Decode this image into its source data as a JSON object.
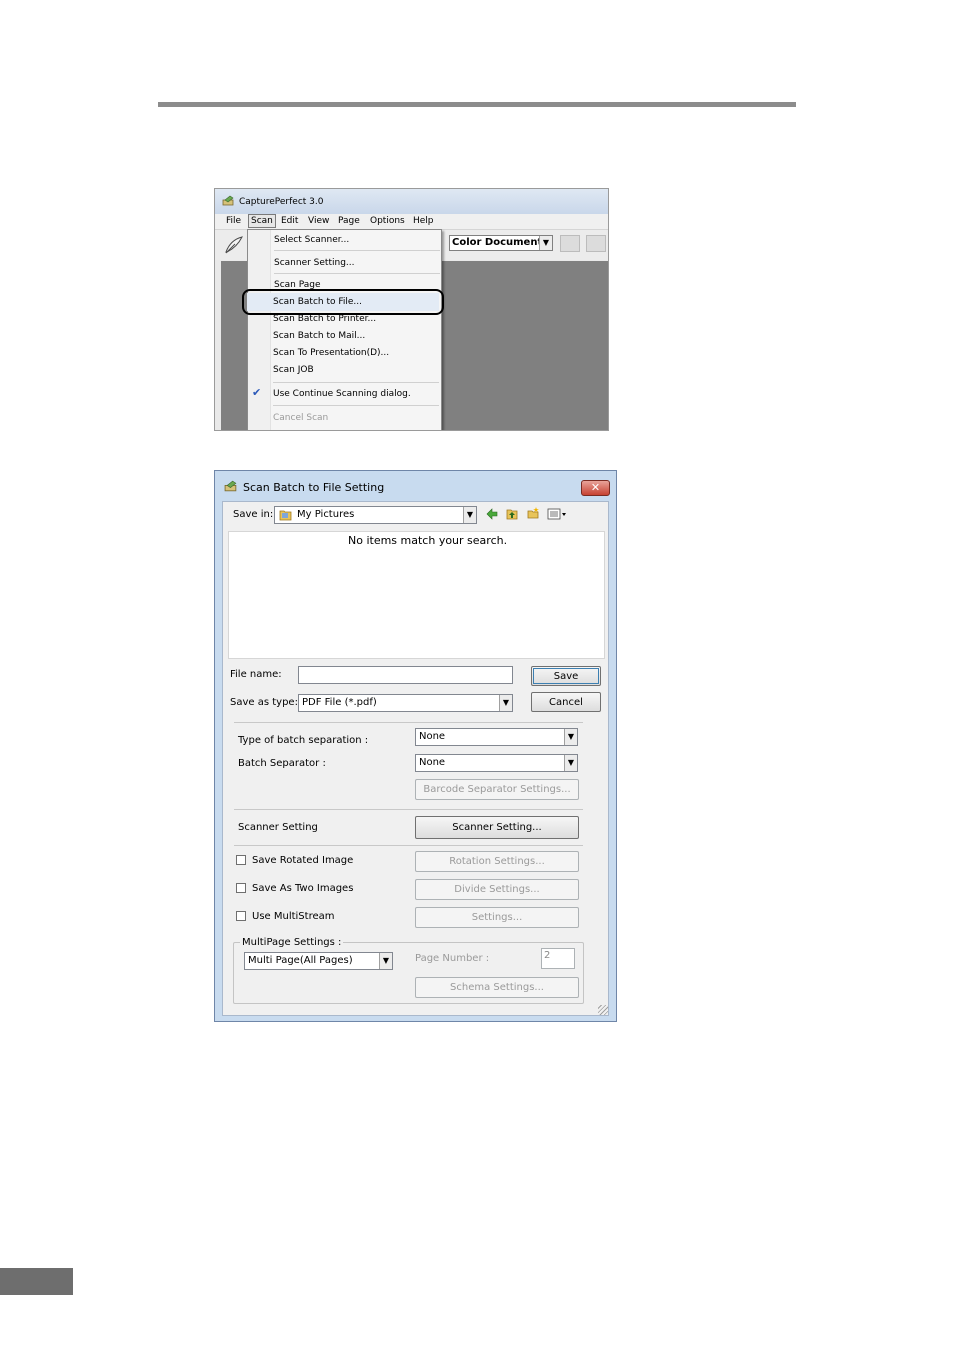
{
  "menu_screenshot": {
    "window_title": "CapturePerfect 3.0",
    "menubar": [
      "File",
      "Scan",
      "Edit",
      "View",
      "Page",
      "Options",
      "Help"
    ],
    "active_menu": "Scan",
    "color_mode": "Color Document",
    "scan_menu": {
      "items": [
        {
          "label": "Select Scanner..."
        },
        {
          "label": "Scanner Setting..."
        },
        {
          "label": "Scan Page"
        },
        {
          "label": "Scan Batch to File..."
        },
        {
          "label": "Scan Batch to Printer..."
        },
        {
          "label": "Scan Batch to Mail..."
        },
        {
          "label": "Scan To Presentation(D)..."
        },
        {
          "label": "Scan JOB"
        },
        {
          "label": "Use Continue Scanning dialog."
        },
        {
          "label": "Cancel Scan"
        }
      ],
      "highlighted": "Scan Batch to File..."
    }
  },
  "dialog": {
    "title": "Scan Batch to File Setting",
    "save_in_label": "Save in:",
    "save_in_value": "My Pictures",
    "empty_message": "No items match your search.",
    "file_name_label": "File name:",
    "file_name_value": "",
    "save_button": "Save",
    "save_as_type_label": "Save as type:",
    "save_as_type_value": "PDF File (*.pdf)",
    "cancel_button": "Cancel",
    "batch_separation_label": "Type of batch separation :",
    "batch_separation_value": "None",
    "batch_separator_label": "Batch Separator :",
    "batch_separator_value": "None",
    "barcode_button": "Barcode Separator Settings...",
    "scanner_setting_label": "Scanner Setting",
    "scanner_setting_button": "Scanner Setting...",
    "save_rotated_label": "Save Rotated Image",
    "rotation_button": "Rotation Settings...",
    "save_two_label": "Save As Two Images",
    "divide_button": "Divide Settings...",
    "multistream_label": "Use MultiStream",
    "settings_button": "Settings...",
    "multipage_group": "MultiPage Settings :",
    "multipage_value": "Multi Page(All Pages)",
    "page_number_label": "Page Number :",
    "page_number_value": "2",
    "schema_button": "Schema Settings..."
  }
}
